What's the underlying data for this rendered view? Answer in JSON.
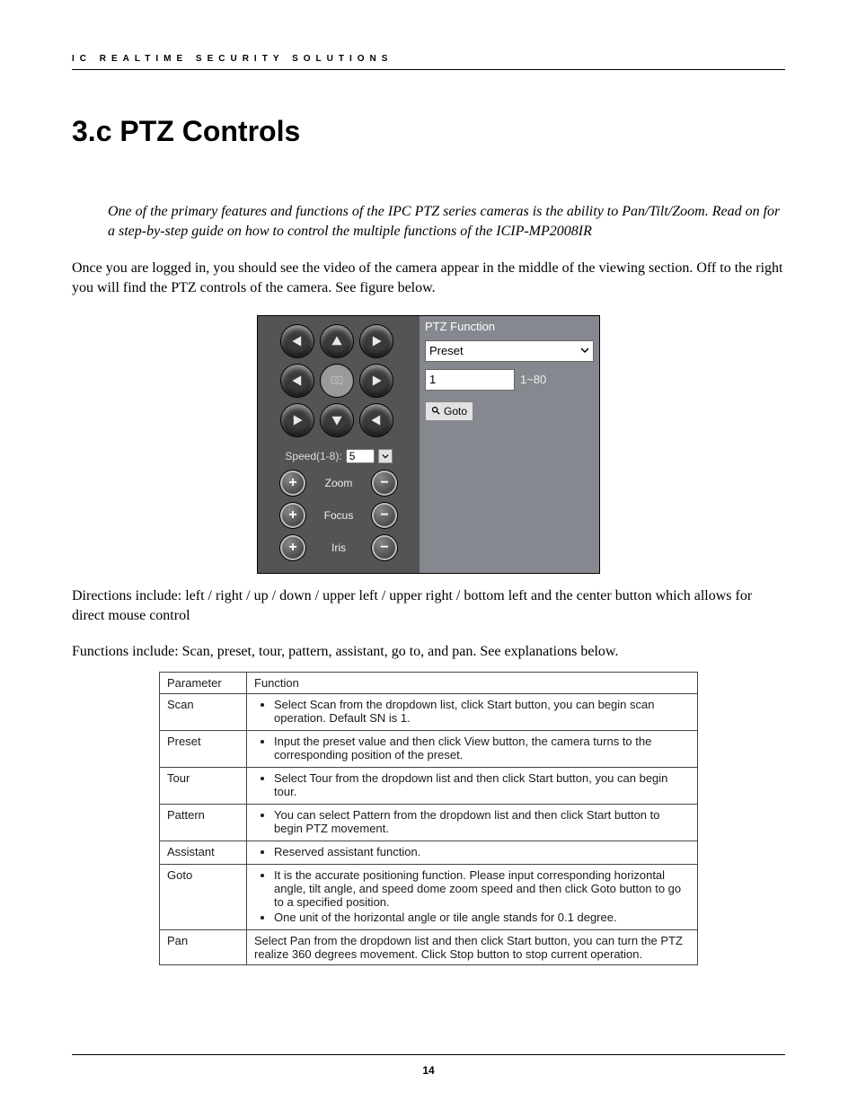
{
  "brand": "IC REALTIME SECURITY SOLUTIONS",
  "heading": "3.c PTZ Controls",
  "intro": "One of the primary features and functions of the IPC PTZ series cameras is the ability to Pan/Tilt/Zoom.  Read on for a step-by-step guide on how to control the multiple functions of the ICIP-MP2008IR",
  "p1": "Once you are logged in, you should see the video of the camera appear in the middle of the viewing section. Off to the right you will find the PTZ controls of the camera. See figure below.",
  "ptz_panel": {
    "title": "PTZ Function",
    "dropdown": "Preset",
    "preset_value": "1",
    "preset_hint": "1~80",
    "goto_label": "Goto",
    "speed_label": "Speed(1-8):",
    "speed_value": "5",
    "controls": {
      "zoom": "Zoom",
      "focus": "Focus",
      "iris": "Iris"
    }
  },
  "p2": "Directions include: left / right / up / down / upper left / upper right / bottom left  and the center button which allows for direct mouse control",
  "p3": " Functions include: Scan, preset, tour, pattern, assistant, go to, and pan. See explanations below.",
  "table": {
    "head": {
      "param": "Parameter",
      "fn": "Function"
    },
    "rows": [
      {
        "param": "Scan",
        "bullets": [
          "Select Scan from the dropdown list, click Start button, you can begin scan operation. Default SN is 1."
        ]
      },
      {
        "param": "Preset",
        "bullets": [
          "Input the preset value and then click View button, the camera turns to the corresponding position of the preset."
        ]
      },
      {
        "param": "Tour",
        "bullets": [
          "Select Tour from the dropdown list and then click Start button, you can begin tour."
        ]
      },
      {
        "param": "Pattern",
        "bullets": [
          "You can select Pattern from the dropdown list and then click Start button to begin PTZ movement."
        ]
      },
      {
        "param": "Assistant",
        "bullets": [
          "Reserved assistant function."
        ]
      },
      {
        "param": "Goto",
        "bullets": [
          "It is the accurate positioning function. Please input corresponding horizontal angle, tilt angle, and speed dome zoom speed and then click Goto button to go to a specified position.",
          "One unit of the horizontal angle or tile angle stands for 0.1 degree."
        ]
      },
      {
        "param": "Pan",
        "text": "Select Pan from the dropdown list and then click Start button, you can turn the PTZ realize 360 degrees movement. Click Stop button to stop current operation."
      }
    ]
  },
  "page_number": "14"
}
